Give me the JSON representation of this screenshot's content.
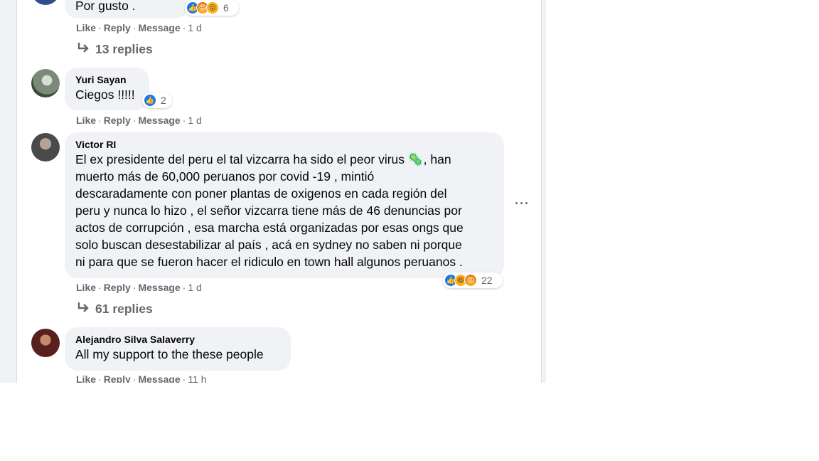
{
  "comments": [
    {
      "text": "Por gusto .",
      "reactions": {
        "icons": [
          "like-reaction",
          "angry-reaction",
          "wow-reaction"
        ],
        "count": "6"
      },
      "actions": {
        "like": "Like",
        "reply": "Reply",
        "message": "Message",
        "time": "1 d"
      },
      "replies": "13 replies"
    },
    {
      "author": "Yuri Sayan",
      "text": "Ciegos !!!!!",
      "reactions": {
        "icons": [
          "like-reaction"
        ],
        "count": "2"
      },
      "actions": {
        "like": "Like",
        "reply": "Reply",
        "message": "Message",
        "time": "1 d"
      }
    },
    {
      "author": "Victor RI",
      "lines": [
        "El ex presidente del peru el tal vizcarra ha sido el peor virus 🦠, han",
        "muerto más de 60,000 peruanos por covid -19 , mintió",
        "descaradamente con poner plantas de oxigenos en cada región del",
        "peru y nunca lo hizo , el señor vizcarra tiene más de 46 denuncias por",
        "actos de corrupción , esa marcha está organizadas por esas ongs que",
        "solo buscan desestabilizar al país , acá en sydney no saben ni porque",
        "ni para que se fueron hacer el ridiculo en town hall algunos peruanos ."
      ],
      "reactions": {
        "icons": [
          "like-reaction",
          "haha-reaction",
          "angry-reaction"
        ],
        "count": "22"
      },
      "actions": {
        "like": "Like",
        "reply": "Reply",
        "message": "Message",
        "time": "1 d"
      },
      "replies": "61 replies",
      "more": "···"
    },
    {
      "author": "Alejandro Silva Salaverry",
      "text": "All my support to the these people",
      "actions": {
        "like": "Like",
        "reply": "Reply",
        "message": "Message",
        "time": "11 h"
      }
    }
  ],
  "colors": {
    "bubble": "#f0f2f5",
    "secondary_text": "#65676b",
    "like_blue": "#1877f2"
  }
}
